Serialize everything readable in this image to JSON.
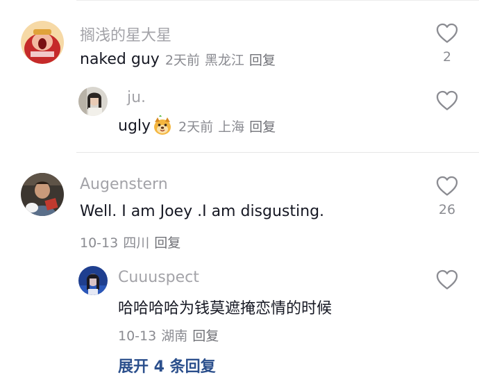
{
  "comments": [
    {
      "username": "搁浅的星大星",
      "text": "naked guy",
      "time": "2天前",
      "location": "黑龙江",
      "reply_label": "回复",
      "likes": "2"
    },
    {
      "username": "ju.",
      "text": "ugly",
      "time": "2天前",
      "location": "上海",
      "reply_label": "回复",
      "likes": ""
    },
    {
      "username": "Augenstern",
      "text": "Well. I am Joey .I am disgusting.",
      "time": "10-13",
      "location": "四川",
      "reply_label": "回复",
      "likes": "26"
    },
    {
      "username": "Cuuuspect",
      "text": "哈哈哈哈为钱莫遮掩恋情的时候",
      "time": "10-13",
      "location": "湖南",
      "reply_label": "回复",
      "likes": ""
    }
  ],
  "expand_replies": "展开 4 条回复",
  "colors": {
    "username": "#a3a3a8",
    "text": "#161823",
    "meta": "#8a8b91",
    "link": "#2b4f8c"
  },
  "icons": {
    "like": "heart-outline-icon",
    "emoji": "dog-face-emoji"
  }
}
